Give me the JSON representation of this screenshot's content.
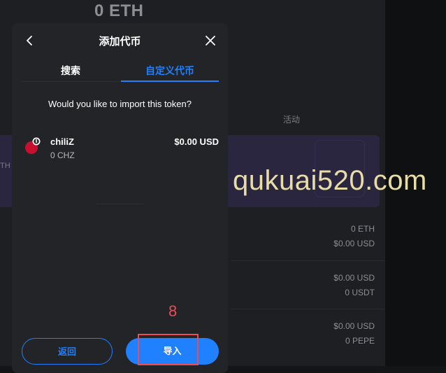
{
  "background": {
    "balance": "0 ETH",
    "activity_tab": "活动",
    "left_banner_text": "TH",
    "assets": [
      {
        "line1": "0 ETH",
        "line2": "$0.00 USD"
      },
      {
        "line1": "$0.00 USD",
        "line2": "0 USDT"
      },
      {
        "line1": "$0.00 USD",
        "line2": "0 PEPE"
      }
    ]
  },
  "modal": {
    "title": "添加代币",
    "tabs": [
      {
        "label": "搜索",
        "active": false
      },
      {
        "label": "自定义代币",
        "active": true
      }
    ],
    "question": "Would you like to import this token?",
    "token": {
      "name": "chiliZ",
      "amount": "0 CHZ",
      "usd_value": "$0.00 USD"
    },
    "buttons": {
      "back_label": "返回",
      "import_label": "导入"
    }
  },
  "annotation": {
    "step_number": "8",
    "color": "#ef4b55"
  },
  "watermark": "qukuai520.com",
  "colors": {
    "accent": "#1f81ff",
    "modal_bg": "#232428",
    "page_bg": "#1e1f22"
  }
}
